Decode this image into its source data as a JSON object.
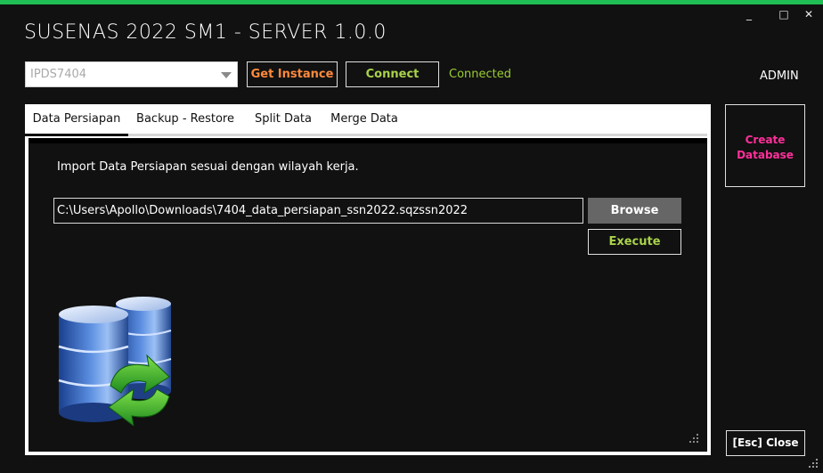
{
  "window": {
    "title": "SUSENAS 2022 SM1 - SERVER 1.0.0",
    "minimize_glyph": "_",
    "maximize_glyph": "□",
    "close_glyph": "✕"
  },
  "connection": {
    "instance_value": "IPDS7404",
    "get_instance_label": "Get Instance",
    "connect_label": "Connect",
    "status_text": "Connected"
  },
  "user": {
    "name": "ADMIN"
  },
  "side_buttons": {
    "create_database_line1": "Create",
    "create_database_line2": "Database",
    "close_label": "[Esc] Close"
  },
  "tabs": [
    {
      "label": "Data Persiapan",
      "active": true
    },
    {
      "label": "Backup - Restore",
      "active": false
    },
    {
      "label": "Split Data",
      "active": false
    },
    {
      "label": "Merge Data",
      "active": false
    }
  ],
  "import_panel": {
    "description": "Import Data Persiapan sesuai dengan wilayah kerja.",
    "file_path": "C:\\Users\\Apollo\\Downloads\\7404_data_persiapan_ssn2022.sqzssn2022",
    "browse_label": "Browse",
    "execute_label": "Execute",
    "illustration_icon": "database-sync-icon"
  },
  "colors": {
    "accent_top_bar": "#1fbf55",
    "get_instance_text": "#ff8a3c",
    "connect_text": "#a9d24b",
    "status_text": "#9acd32",
    "create_database_text": "#ff2f9a",
    "background": "#111111"
  }
}
